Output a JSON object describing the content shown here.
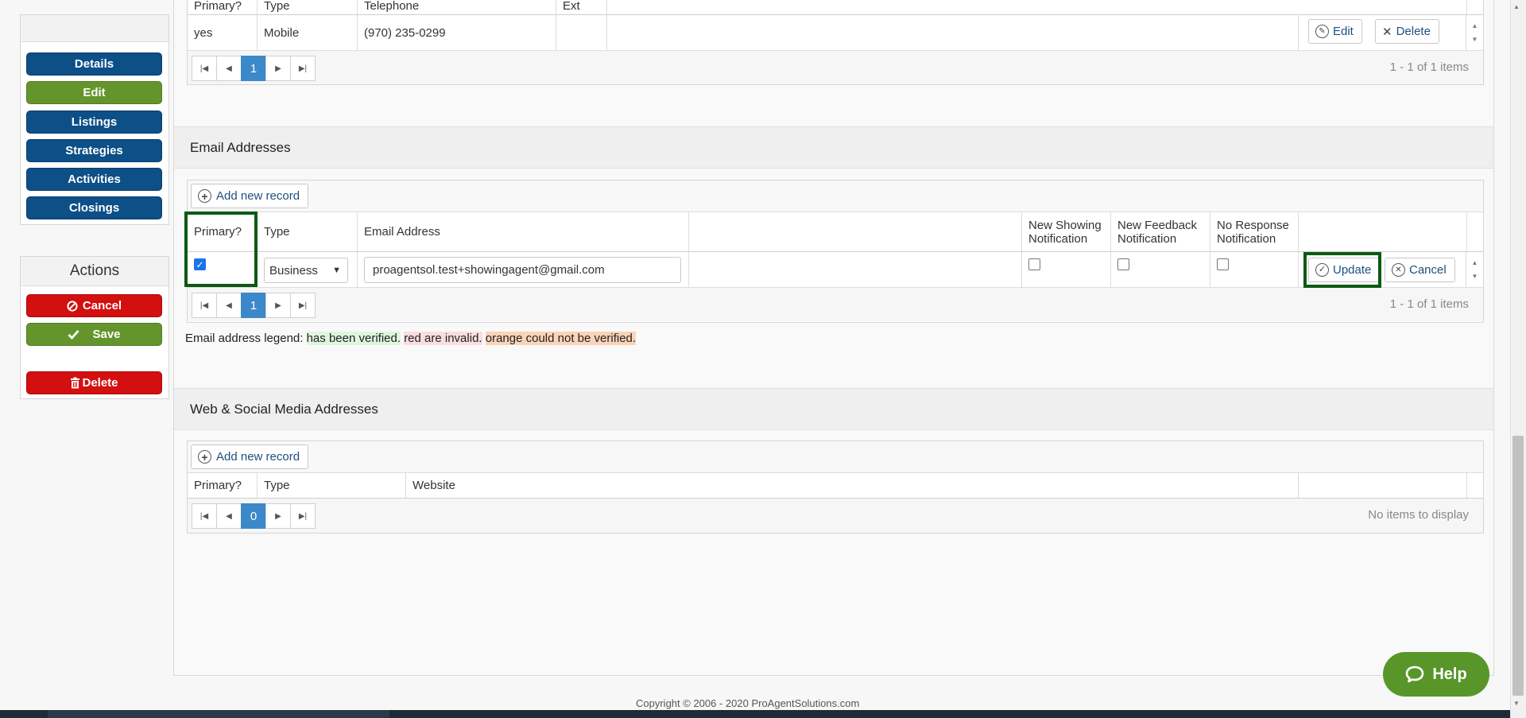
{
  "sidebar": {
    "nav": [
      "Details",
      "Edit",
      "Listings",
      "Strategies",
      "Activities",
      "Closings"
    ],
    "actions_title": "Actions",
    "cancel": "Cancel",
    "save": "Save",
    "delete": "Delete"
  },
  "phones": {
    "headers": [
      "Primary?",
      "Type",
      "Telephone",
      "Ext"
    ],
    "row": {
      "primary": "yes",
      "type": "Mobile",
      "telephone": "(970) 235-0299",
      "ext": ""
    },
    "edit": "Edit",
    "delete": "Delete",
    "page": "1",
    "info": "1 - 1 of 1 items"
  },
  "email": {
    "title": "Email Addresses",
    "add": "Add new record",
    "headers": {
      "primary": "Primary?",
      "type": "Type",
      "email": "Email Address",
      "showing": [
        "New Showing",
        "Notification"
      ],
      "feedback": [
        "New Feedback",
        "Notification"
      ],
      "noresp": [
        "No Response",
        "Notification"
      ]
    },
    "row": {
      "primary_checked": true,
      "type": "Business",
      "email": "proagentsol.test+showingagent@gmail.com",
      "showing": false,
      "feedback": false,
      "noresp": false
    },
    "update": "Update",
    "cancel": "Cancel",
    "page": "1",
    "info": "1 - 1 of 1 items",
    "legend": {
      "prefix": "Email address legend:",
      "verified": "has been verified.",
      "invalid": "red are invalid.",
      "unverified": "orange could not be verified."
    }
  },
  "web": {
    "title": "Web & Social Media Addresses",
    "add": "Add new record",
    "headers": [
      "Primary?",
      "Type",
      "Website"
    ],
    "page": "0",
    "info": "No items to display"
  },
  "footer": "Copyright © 2006 - 2020 ProAgentSolutions.com",
  "help": "Help",
  "colors": {
    "nav_blue": "#0d4f87",
    "nav_green": "#63952c",
    "danger_red": "#d30f0f",
    "pager_active": "#3c89c9",
    "highlight": "#0c5a12"
  }
}
